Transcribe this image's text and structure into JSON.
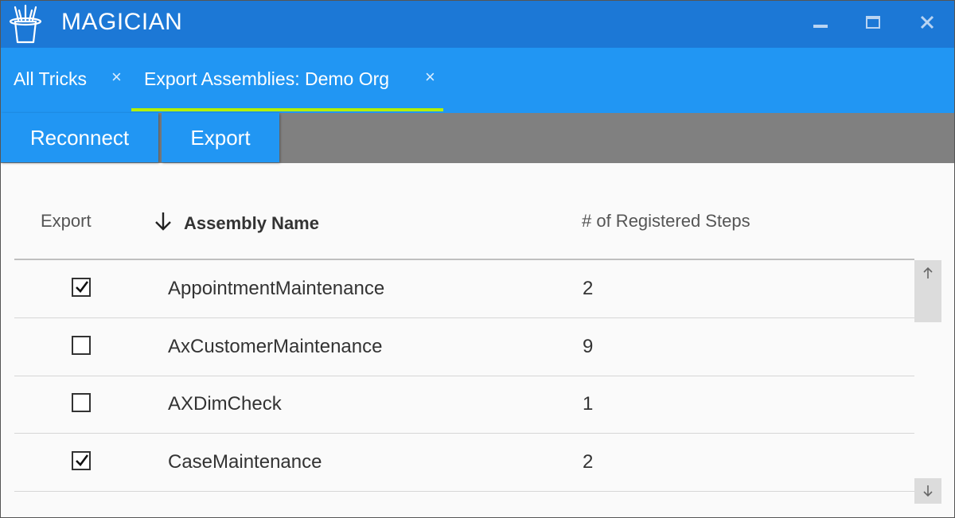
{
  "app": {
    "title": "MAGICIAN",
    "icon": "magic-hat-icon",
    "window_controls": [
      "minimize-icon",
      "maximize-icon",
      "close-icon"
    ]
  },
  "tabs": [
    {
      "label": "All Tricks",
      "close": "×",
      "active": false
    },
    {
      "label": "Export Assemblies: Demo Org",
      "close": "×",
      "active": true
    }
  ],
  "toolbar": {
    "reconnect_label": "Reconnect",
    "export_label": "Export"
  },
  "grid": {
    "headers": {
      "export": "Export",
      "assembly_name": "Assembly Name",
      "steps": "# of Registered Steps"
    },
    "sort_icon": "arrow-down-icon",
    "rows": [
      {
        "checked": true,
        "name": "AppointmentMaintenance",
        "steps": "2"
      },
      {
        "checked": false,
        "name": "AxCustomerMaintenance",
        "steps": "9"
      },
      {
        "checked": false,
        "name": "AXDimCheck",
        "steps": "1"
      },
      {
        "checked": true,
        "name": "CaseMaintenance",
        "steps": "2"
      }
    ]
  },
  "colors": {
    "titlebar": "#1c78d6",
    "tabbar": "#2196f3",
    "tab_underline": "#b4f000",
    "toolbar_bg": "#808080"
  }
}
